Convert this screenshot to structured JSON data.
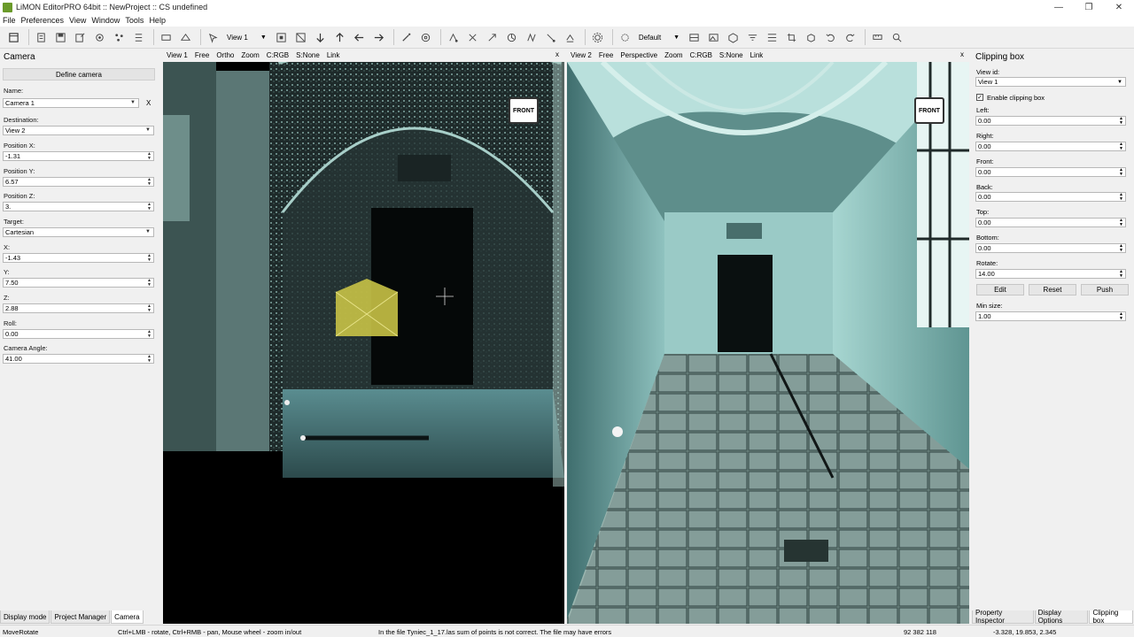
{
  "window": {
    "title": "LiMON EditorPRO 64bit :: NewProject :: CS undefined",
    "controls": [
      "—",
      "❐",
      "✕"
    ]
  },
  "menu": [
    "File",
    "Preferences",
    "View",
    "Window",
    "Tools",
    "Help"
  ],
  "toolbar": {
    "view_combo": "View 1",
    "default_combo": "Default"
  },
  "camera_panel": {
    "title": "Camera",
    "define_button": "Define camera",
    "name_label": "Name:",
    "name_value": "Camera 1",
    "remove_label": "X",
    "destination_label": "Destination:",
    "destination_value": "View 2",
    "pos_x_label": "Position X:",
    "pos_x_value": "-1.31",
    "pos_y_label": "Position Y:",
    "pos_y_value": "6.57",
    "pos_z_label": "Position Z:",
    "pos_z_value": "3.",
    "target_label": "Target:",
    "target_value": "Cartesian",
    "x_label": "X:",
    "x_value": "-1.43",
    "y_label": "Y:",
    "y_value": "7.50",
    "z_label": "Z:",
    "z_value": "2.88",
    "roll_label": "Roll:",
    "roll_value": "0.00",
    "angle_label": "Camera Angle:",
    "angle_value": "41.00"
  },
  "left_tabs": [
    "Display mode",
    "Project Manager",
    "Camera"
  ],
  "view1": {
    "tabs": [
      "View 1",
      "Free",
      "Ortho",
      "Zoom",
      "C:RGB",
      "S:None",
      "Link"
    ],
    "close": "x",
    "cube_label": "FRONT"
  },
  "view2": {
    "tabs": [
      "View 2",
      "Free",
      "Perspective",
      "Zoom",
      "C:RGB",
      "S:None",
      "Link"
    ],
    "close": "x",
    "cube_label": "FRONT"
  },
  "clipping_panel": {
    "title": "Clipping box",
    "view_id_label": "View id:",
    "view_id_value": "View 1",
    "enable_label": "Enable clipping box",
    "left_label": "Left:",
    "left_value": "0.00",
    "right_label": "Right:",
    "right_value": "0.00",
    "front_label": "Front:",
    "front_value": "0.00",
    "back_label": "Back:",
    "back_value": "0.00",
    "top_label": "Top:",
    "top_value": "0.00",
    "bottom_label": "Bottom:",
    "bottom_value": "0.00",
    "rotate_label": "Rotate:",
    "rotate_value": "14.00",
    "edit_button": "Edit",
    "reset_button": "Reset",
    "push_button": "Push",
    "min_size_label": "Min size:",
    "min_size_value": "1.00"
  },
  "right_tabs": [
    "Property Inspector",
    "Display Options",
    "Clipping box"
  ],
  "status": {
    "mode": "MoveRotate",
    "hint": "Ctrl+LMB - rotate, Ctrl+RMB - pan, Mouse wheel - zoom in/out",
    "message": "In the file Tyniec_1_17.las sum of points is not correct. The file may have errors",
    "points": "92 382 118",
    "coords": "-3.328, 19.853, 2.345"
  }
}
